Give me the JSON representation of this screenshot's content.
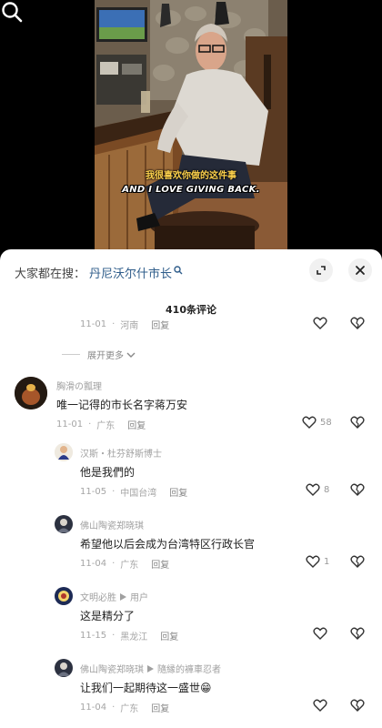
{
  "subtitle": {
    "cn": "我很喜欢你做的这件事",
    "en": "AND I LOVE GIVING BACK."
  },
  "search": {
    "prefix": "大家都在搜：",
    "keyword": "丹尼沃尔什市长"
  },
  "comment_count": "410条评论",
  "prev_comment": {
    "date": "11-01",
    "location": "河南",
    "reply": "回复"
  },
  "expand_more": "展开更多",
  "comments": [
    {
      "user": "胸滑の瓢理",
      "text": "唯一记得的市长名字蒋万安",
      "date": "11-01",
      "location": "广东",
      "reply": "回复",
      "likes": "58"
    },
    {
      "user": "汉斯・杜芬舒斯博士",
      "text": "他是我們的",
      "date": "11-05",
      "location": "中国台湾",
      "reply": "回复",
      "likes": "8"
    },
    {
      "user": "佛山陶瓷郑晓琪",
      "text": "希望他以后会成为台湾特区行政长官",
      "date": "11-04",
      "location": "广东",
      "reply": "回复",
      "likes": "1"
    },
    {
      "user": "文明必胜",
      "reply_to": "用户",
      "text": "这是精分了",
      "date": "11-15",
      "location": "黑龙江",
      "reply": "回复",
      "likes": ""
    },
    {
      "user": "佛山陶瓷郑晓琪",
      "reply_to": "隨縁的褲車忍者",
      "text": "让我们一起期待这一盛世😁",
      "date": "11-04",
      "location": "广东",
      "reply": "回复",
      "likes": ""
    }
  ]
}
